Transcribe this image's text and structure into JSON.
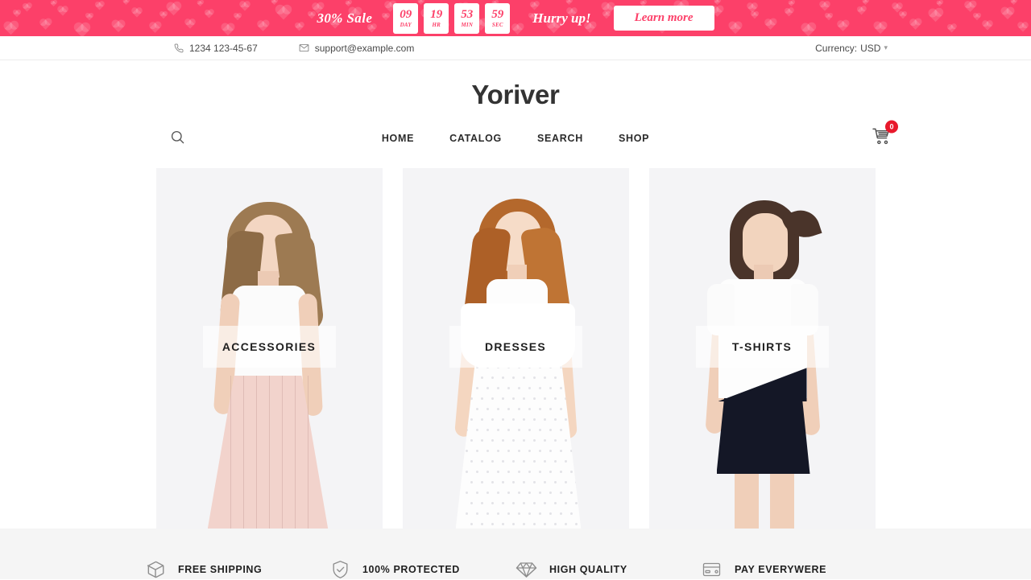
{
  "promo": {
    "sale_text": "30% Sale",
    "countdown": [
      {
        "value": "09",
        "label": "DAY"
      },
      {
        "value": "19",
        "label": "HR"
      },
      {
        "value": "53",
        "label": "MIN"
      },
      {
        "value": "59",
        "label": "SEC"
      }
    ],
    "hurry_text": "Hurry up!",
    "cta_label": "Learn more",
    "background_color": "#fc4069",
    "accent_color": "#ffffff"
  },
  "infobar": {
    "phone": "1234 123-45-67",
    "email": "support@example.com",
    "phone_icon": "phone-icon",
    "email_icon": "envelope-icon",
    "currency_label": "Currency:",
    "currency_value": "USD",
    "chevron": "ˇ"
  },
  "header": {
    "logo": "Yoriver",
    "search_icon": "search-icon",
    "cart_icon": "shopping-cart-icon",
    "cart_count": "0",
    "cart_badge_color": "#e8192c",
    "nav": [
      {
        "label": "HOME"
      },
      {
        "label": "CATALOG"
      },
      {
        "label": "SEARCH"
      },
      {
        "label": "SHOP"
      }
    ]
  },
  "categories": [
    {
      "label": "ACCESSORIES"
    },
    {
      "label": "DRESSES"
    },
    {
      "label": "T-SHIRTS"
    }
  ],
  "features": [
    {
      "label": "FREE SHIPPING",
      "icon": "package-box-icon"
    },
    {
      "label": "100% PROTECTED",
      "icon": "shield-check-icon"
    },
    {
      "label": "HIGH QUALITY",
      "icon": "diamond-icon"
    },
    {
      "label": "PAY EVERYWERE",
      "icon": "credit-card-icon"
    }
  ]
}
